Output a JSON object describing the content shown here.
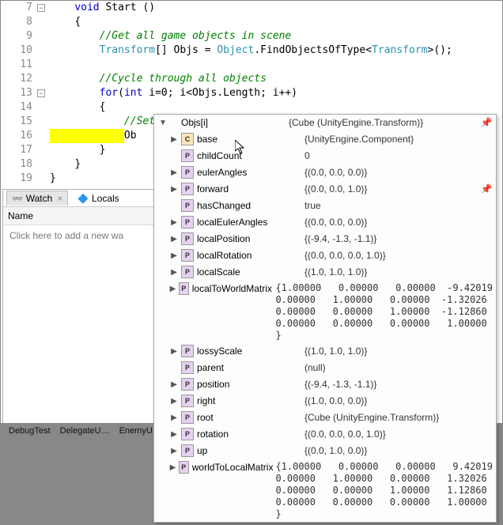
{
  "editor": {
    "lines": [
      {
        "num": 7,
        "fold": "open"
      },
      {
        "num": 8
      },
      {
        "num": 9
      },
      {
        "num": 10
      },
      {
        "num": 11
      },
      {
        "num": 12
      },
      {
        "num": 13,
        "fold": "open"
      },
      {
        "num": 14
      },
      {
        "num": 15
      },
      {
        "num": 16,
        "current": true
      },
      {
        "num": 17
      },
      {
        "num": 18
      },
      {
        "num": 19
      }
    ],
    "code": {
      "l7_kw": "void",
      "l7_name": " Start ()",
      "l8": "{",
      "l9_comment": "//Get all game objects in scene",
      "l10_type1": "Transform",
      "l10_mid": "[] Objs = ",
      "l10_type2": "Object",
      "l10_call": ".FindObjectsOfType<",
      "l10_type3": "Transform",
      "l10_end": ">();",
      "l12_comment": "//Cycle through all objects",
      "l13_for": "for",
      "l13_int": "int",
      "l13_rest": " i=0; i<Objs.Length; i++)",
      "l14": "{",
      "l15_comment": "//Set object to world origin",
      "l16_highlight_pad": "            ",
      "l16_text": "Ob",
      "l17": "}",
      "l18": "}",
      "l19": "}"
    }
  },
  "watch": {
    "tab_watch": "Watch",
    "tab_locals": "Locals",
    "col_name": "Name",
    "hint": "Click here to add a new wa"
  },
  "bottom": {
    "tabs": [
      "DebugTest",
      "DelegateU…",
      "EnemyU"
    ]
  },
  "tooltip": {
    "root": {
      "name": "Objs[i]",
      "value": "{Cube (UnityEngine.Transform)}",
      "pinned": true
    },
    "rows": [
      {
        "icon": "cls",
        "exp": "closed",
        "name": "base",
        "value": "{UnityEngine.Component}"
      },
      {
        "icon": "prop",
        "exp": "none",
        "name": "childCount",
        "value": "0"
      },
      {
        "icon": "prop",
        "exp": "closed",
        "name": "eulerAngles",
        "value": "{(0.0, 0.0, 0.0)}"
      },
      {
        "icon": "prop",
        "exp": "closed",
        "name": "forward",
        "value": "{(0.0, 0.0, 1.0)}",
        "pinned": true
      },
      {
        "icon": "prop",
        "exp": "none",
        "name": "hasChanged",
        "value": "true"
      },
      {
        "icon": "prop",
        "exp": "closed",
        "name": "localEulerAngles",
        "value": "{(0.0, 0.0, 0.0)}"
      },
      {
        "icon": "prop",
        "exp": "closed",
        "name": "localPosition",
        "value": "{(-9.4, -1.3, -1.1)}"
      },
      {
        "icon": "prop",
        "exp": "closed",
        "name": "localRotation",
        "value": "{(0.0, 0.0, 0.0, 1.0)}"
      },
      {
        "icon": "prop",
        "exp": "closed",
        "name": "localScale",
        "value": "{(1.0, 1.0, 1.0)}"
      },
      {
        "icon": "prop",
        "exp": "closed",
        "name": "localToWorldMatrix",
        "matrix": "{1.00000   0.00000   0.00000  -9.42019\n0.00000   1.00000   0.00000  -1.32026\n0.00000   0.00000   1.00000  -1.12860\n0.00000   0.00000   0.00000   1.00000\n}"
      },
      {
        "icon": "prop",
        "exp": "closed",
        "name": "lossyScale",
        "value": "{(1.0, 1.0, 1.0)}"
      },
      {
        "icon": "prop",
        "exp": "none",
        "name": "parent",
        "value": "(null)"
      },
      {
        "icon": "prop",
        "exp": "closed",
        "name": "position",
        "value": "{(-9.4, -1.3, -1.1)}"
      },
      {
        "icon": "prop",
        "exp": "closed",
        "name": "right",
        "value": "{(1.0, 0.0, 0.0)}"
      },
      {
        "icon": "prop",
        "exp": "closed",
        "name": "root",
        "value": "{Cube (UnityEngine.Transform)}"
      },
      {
        "icon": "prop",
        "exp": "closed",
        "name": "rotation",
        "value": "{(0.0, 0.0, 0.0, 1.0)}"
      },
      {
        "icon": "prop",
        "exp": "closed",
        "name": "up",
        "value": "{(0.0, 1.0, 0.0)}"
      },
      {
        "icon": "prop",
        "exp": "closed",
        "name": "worldToLocalMatrix",
        "matrix": "{1.00000   0.00000   0.00000   9.42019\n0.00000   1.00000   0.00000   1.32026\n0.00000   0.00000   1.00000   1.12860\n0.00000   0.00000   0.00000   1.00000\n}"
      }
    ]
  },
  "icons": {
    "cls": "C",
    "prop": "P",
    "pin": "📌"
  }
}
